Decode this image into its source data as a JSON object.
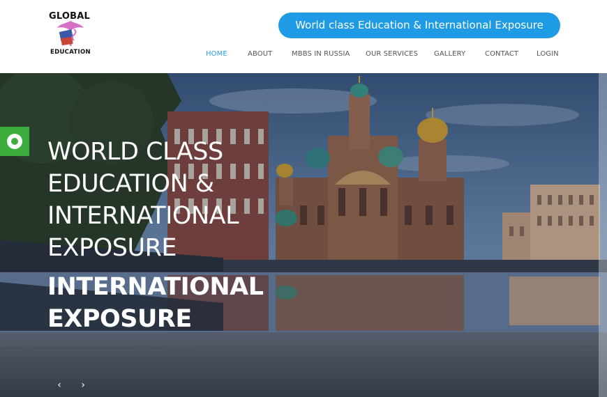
{
  "logo": {
    "top_text": "GLOBAL",
    "bottom_text": "EDUCATION"
  },
  "tagline": "World class Education & International Exposure",
  "nav": {
    "items": [
      {
        "label": "HOME",
        "active": true
      },
      {
        "label": "ABOUT"
      },
      {
        "label": "MBBS IN RUSSIA"
      },
      {
        "label": "OUR SERVICES"
      },
      {
        "label": "GALLERY"
      },
      {
        "label": "CONTACT"
      },
      {
        "label": "LOGIN"
      }
    ]
  },
  "hero": {
    "title_lines": [
      "WORLD CLASS",
      "EDUCATION &",
      "INTERNATIONAL",
      "EXPOSURE"
    ],
    "subtitle_lines": [
      "INTERNATIONAL",
      "EXPOSURE"
    ],
    "prev_icon": "chevron-left-icon",
    "next_icon": "chevron-right-icon",
    "prev_glyph": "‹",
    "next_glyph": "›"
  },
  "whatsapp_icon": "whatsapp-icon",
  "colors": {
    "accent": "#1f9be6",
    "nav_active": "#2a9be0",
    "whatsapp": "#3cac3c"
  }
}
